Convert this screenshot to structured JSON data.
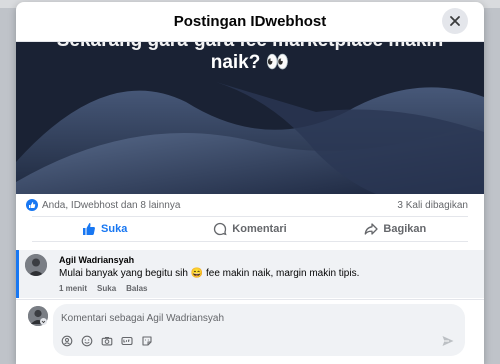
{
  "modal": {
    "title": "Postingan IDwebhost"
  },
  "post": {
    "caption_line_top": "Sekarang gara-gara fee marketplace makin",
    "caption_line_main": "naik? 👀"
  },
  "reactions": {
    "summary": "Anda, IDwebhost dan 8 lainnya",
    "shares": "3 Kali dibagikan"
  },
  "actions": {
    "like": "Suka",
    "comment": "Komentari",
    "share": "Bagikan"
  },
  "comment": {
    "author": "Agil Wadriansyah",
    "text": "Mulai banyak yang begitu sih 😄 fee makin naik, margin makin tipis.",
    "time": "1 menit",
    "like": "Suka",
    "reply": "Balas"
  },
  "composer": {
    "placeholder": "Komentari sebagai Agil Wadriansyah"
  },
  "colors": {
    "accent": "#1877f2",
    "muted": "#65676b"
  }
}
